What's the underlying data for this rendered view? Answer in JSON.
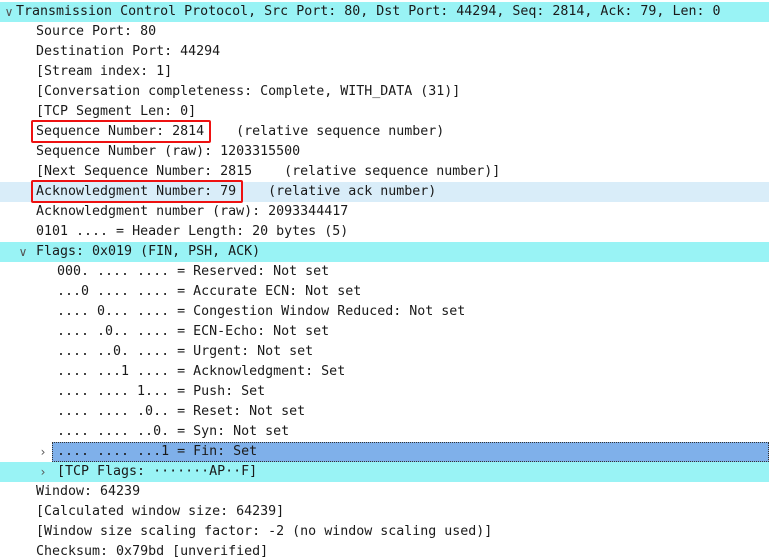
{
  "rows": [
    {
      "level": 0,
      "arrow": "v",
      "text": "Transmission Control Protocol, Src Port: 80, Dst Port: 44294, Seq: 2814, Ack: 79, Len: 0",
      "hl": "cyan",
      "name": "tcp-header-row",
      "interactable": true
    },
    {
      "level": 1,
      "text": "Source Port: 80",
      "name": "source-port-row"
    },
    {
      "level": 1,
      "text": "Destination Port: 44294",
      "name": "destination-port-row"
    },
    {
      "level": 1,
      "text": "[Stream index: 1]",
      "name": "stream-index-row"
    },
    {
      "level": 1,
      "text": "[Conversation completeness: Complete, WITH_DATA (31)]",
      "name": "conversation-completeness-row"
    },
    {
      "level": 1,
      "text": "[TCP Segment Len: 0]",
      "name": "tcp-segment-len-row"
    },
    {
      "level": 1,
      "text": "Sequence Number: 2814",
      "suffix": "    (relative sequence number)",
      "name": "sequence-number-row",
      "box": true
    },
    {
      "level": 1,
      "text": "Sequence Number (raw): 1203315500",
      "name": "sequence-number-raw-row"
    },
    {
      "level": 1,
      "text": "[Next Sequence Number: 2815    (relative sequence number)]",
      "name": "next-sequence-number-row"
    },
    {
      "level": 1,
      "text": "Acknowledgment Number: 79",
      "suffix": "    (relative ack number)",
      "name": "acknowledgment-number-row",
      "hl": "pale",
      "box": true
    },
    {
      "level": 1,
      "text": "Acknowledgment number (raw): 2093344417",
      "name": "acknowledgment-number-raw-row"
    },
    {
      "level": 1,
      "text": "0101 .... = Header Length: 20 bytes (5)",
      "name": "header-length-row"
    },
    {
      "level": 1,
      "arrow": "v",
      "text": "Flags: 0x019 (FIN, PSH, ACK)",
      "hl": "cyan",
      "name": "flags-row",
      "interactable": true
    },
    {
      "level": 2,
      "text": "000. .... .... = Reserved: Not set",
      "name": "flag-reserved-row"
    },
    {
      "level": 2,
      "text": "...0 .... .... = Accurate ECN: Not set",
      "name": "flag-accurate-ecn-row"
    },
    {
      "level": 2,
      "text": ".... 0... .... = Congestion Window Reduced: Not set",
      "name": "flag-cwr-row"
    },
    {
      "level": 2,
      "text": ".... .0.. .... = ECN-Echo: Not set",
      "name": "flag-ecn-echo-row"
    },
    {
      "level": 2,
      "text": ".... ..0. .... = Urgent: Not set",
      "name": "flag-urgent-row"
    },
    {
      "level": 2,
      "text": ".... ...1 .... = Acknowledgment: Set",
      "name": "flag-acknowledgment-row"
    },
    {
      "level": 2,
      "text": ".... .... 1... = Push: Set",
      "name": "flag-push-row"
    },
    {
      "level": 2,
      "text": ".... .... .0.. = Reset: Not set",
      "name": "flag-reset-row"
    },
    {
      "level": 2,
      "text": ".... .... ..0. = Syn: Not set",
      "name": "flag-syn-row"
    },
    {
      "level": 2,
      "arrow": ">",
      "text": ".... .... ...1 = Fin: Set",
      "hl": "sel",
      "name": "flag-fin-row",
      "interactable": true,
      "focus": true
    },
    {
      "level": 2,
      "arrow": ">",
      "text": "[TCP Flags: ·······AP··F]",
      "hl": "cyan",
      "name": "tcp-flags-summary-row",
      "interactable": true
    },
    {
      "level": 1,
      "text": "Window: 64239",
      "name": "window-row"
    },
    {
      "level": 1,
      "text": "[Calculated window size: 64239]",
      "name": "calculated-window-size-row"
    },
    {
      "level": 1,
      "text": "[Window size scaling factor: -2 (no window scaling used)]",
      "name": "window-scaling-factor-row"
    },
    {
      "level": 1,
      "text": "Checksum: 0x79bd [unverified]",
      "name": "checksum-row"
    }
  ]
}
